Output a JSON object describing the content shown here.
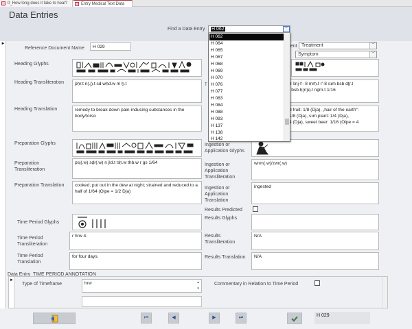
{
  "tabs": [
    {
      "label": "0_How long does it take to heal?",
      "active": false
    },
    {
      "label": "Entry Medical Text Data",
      "active": true
    }
  ],
  "page_title": "Data Entries",
  "find": {
    "label": "Find a Data Entry",
    "value": "H 062",
    "options": [
      "H 062",
      "H 064",
      "H 065",
      "H 067",
      "H 068",
      "H 069",
      "H 070",
      "H 076",
      "H 077",
      "H 083",
      "H 084",
      "H 088",
      "H 093",
      "H 137",
      "H 138",
      "H 142"
    ]
  },
  "reference": {
    "label": "Reference Document Name",
    "value": "H 029"
  },
  "component": {
    "label_partial": "ent",
    "value": "Treatment"
  },
  "category": {
    "value": "Symptom"
  },
  "heading": {
    "glyphs_label": "Heading Glyphs",
    "translit_label": "Heading Transliteration",
    "translit": "pḥr.t n(.j).t sd wḥd.w m ẖ.t",
    "translation_label": "Heading Translation",
    "translation": "remedy to break down pain-inducing substances in the body/torso"
  },
  "right_partial": {
    "label_t": "T",
    "text1_line1": "8 šnj-t'- 8 mrḥ.t r'-8 sꜣm bsb dṯr.t",
    "text1_line2": "l bsb ḥ(n)q.t nḏm.t 1/16",
    "text2_line1": "d fruit: 1/8 (Dja), „hair of the earth“:",
    "text2_line2": "1/8 (Dja), sꜣm plant: 1/4 (Dja),",
    "text2_line3": "4 (Dja), sweet beer: 1/16 (Oipe = 4"
  },
  "preparation": {
    "glyphs_label": "Preparation Glyphs",
    "translit_label": "Preparation Transliteration",
    "translit": "psj(.w) sḏr(.w) n jld.t tꜣḥ.w thb.w r gs 1/64",
    "translation_label": "Preparation Translation",
    "translation": "cooked; put out in the dew at night; strained and reduced to a half of 1/64 (Oipe = 1/2 Dja)"
  },
  "ingestion": {
    "glyphs_label": "Ingestion or Application Glyphs",
    "translit_label": "Ingestion or Application Transliteration",
    "translit": "wnm(.w)/zwr(.w)",
    "translation_label": "Ingestion or Application Translation",
    "translation": "ingested"
  },
  "results": {
    "predicted_label": "Results Predicted",
    "predicted_checked": false,
    "glyphs_label": "Results Glyphs",
    "translit_label": "Results Transliteration",
    "translit": "N/A",
    "translation_label": "Results Translation",
    "translation": "N/A"
  },
  "time_period": {
    "glyphs_label": "Time Period Glyphs",
    "translit_label": "Time Period Transliteration",
    "translit": "r hrw 4.",
    "translation_label": "Time Period Translation",
    "translation": "for four days."
  },
  "annotation": {
    "section_label": "Data Entry_TIME PERIOD ANNOTATION",
    "type_label": "Type of Timeframe",
    "type_value": "hrw",
    "commentary_label": "Commentary in Relation to Time Period",
    "commentary_checked": false
  },
  "footer": {
    "record_value": "H 029"
  },
  "icons": [
    "form-icon",
    "record-selector-icon",
    "chevron-down-icon",
    "first-record-icon",
    "previous-record-icon",
    "next-record-icon",
    "last-record-icon",
    "close-form-icon",
    "save-icon"
  ]
}
